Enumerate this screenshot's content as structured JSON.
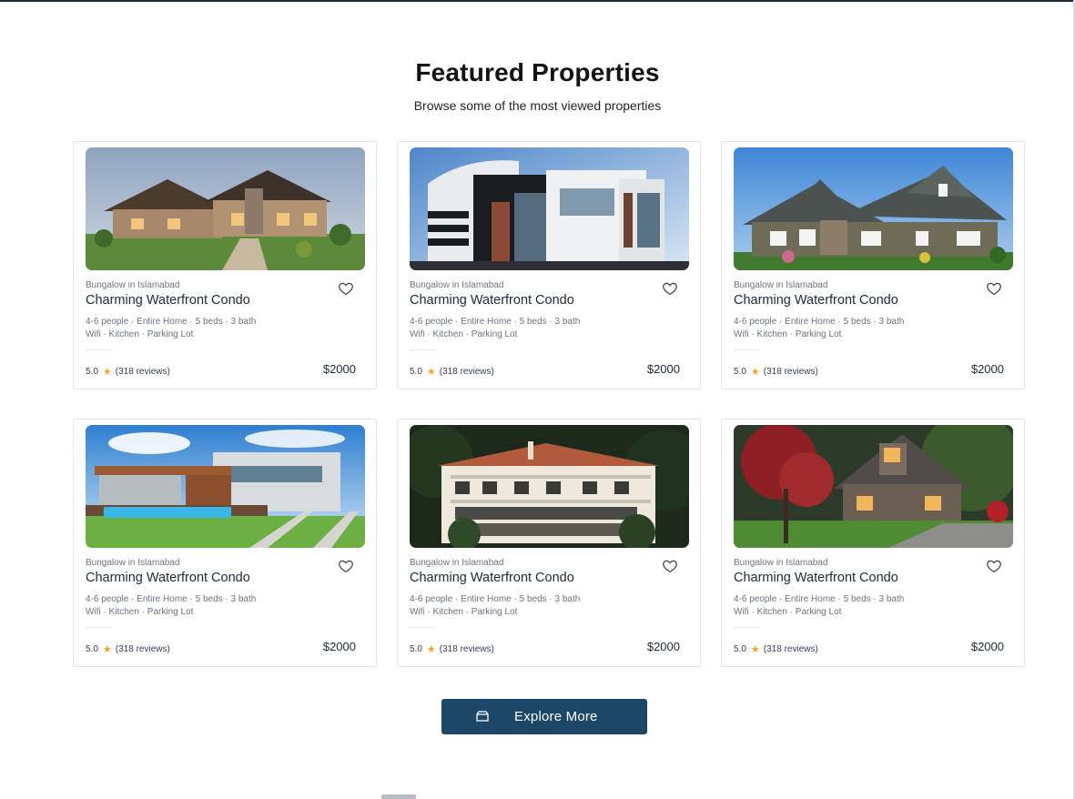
{
  "section": {
    "title": "Featured Properties",
    "subtitle": "Browse some of the most viewed properties"
  },
  "cards": [
    {
      "type": "Bungalow in Islamabad",
      "name": "Charming Waterfront Condo",
      "details": "4-6 people · Entire Home · 5 beds · 3 bath",
      "amenities": "Wifi · Kitchen · Parking Lot",
      "rating": "5.0",
      "reviews": "(318 reviews)",
      "price": "$2000"
    },
    {
      "type": "Bungalow in Islamabad",
      "name": "Charming Waterfront Condo",
      "details": "4-6 people · Entire Home · 5 beds · 3 bath",
      "amenities": "Wifi · Kitchen · Parking Lot",
      "rating": "5.0",
      "reviews": "(318 reviews)",
      "price": "$2000"
    },
    {
      "type": "Bungalow in Islamabad",
      "name": "Charming Waterfront Condo",
      "details": "4-6 people · Entire Home · 5 beds · 3 bath",
      "amenities": "Wifi · Kitchen · Parking Lot",
      "rating": "5.0",
      "reviews": "(318 reviews)",
      "price": "$2000"
    },
    {
      "type": "Bungalow in Islamabad",
      "name": "Charming Waterfront Condo",
      "details": "4-6 people · Entire Home · 5 beds · 3 bath",
      "amenities": "Wifi · Kitchen · Parking Lot",
      "rating": "5.0",
      "reviews": "(318 reviews)",
      "price": "$2000"
    },
    {
      "type": "Bungalow in Islamabad",
      "name": "Charming Waterfront Condo",
      "details": "4-6 people · Entire Home · 5 beds · 3 bath",
      "amenities": "Wifi · Kitchen · Parking Lot",
      "rating": "5.0",
      "reviews": "(318 reviews)",
      "price": "$2000"
    },
    {
      "type": "Bungalow in Islamabad",
      "name": "Charming Waterfront Condo",
      "details": "4-6 people · Entire Home · 5 beds · 3 bath",
      "amenities": "Wifi · Kitchen · Parking Lot",
      "rating": "5.0",
      "reviews": "(318 reviews)",
      "price": "$2000"
    }
  ],
  "explore": {
    "label": "Explore More",
    "icon": "box-icon"
  },
  "colors": {
    "primary_button": "#1d4766",
    "star": "#f5a524"
  }
}
